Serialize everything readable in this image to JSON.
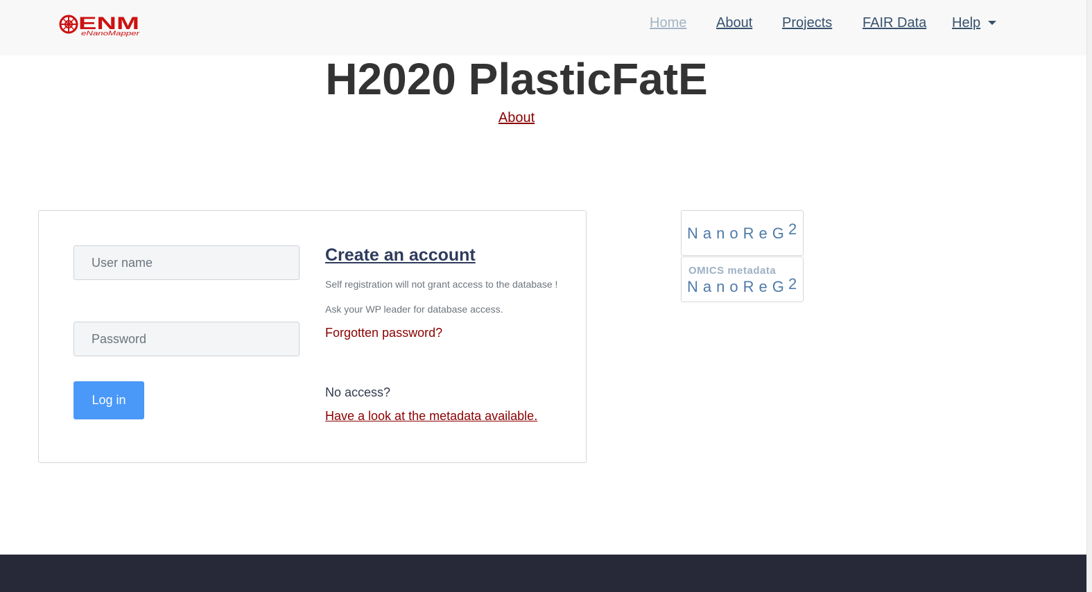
{
  "nav": {
    "logo_text": "ENM",
    "logo_subtext": "eNanoMapper",
    "items": [
      {
        "label": "Home",
        "active": true
      },
      {
        "label": "About"
      },
      {
        "label": "Projects"
      },
      {
        "label": "FAIR Data"
      },
      {
        "label": "Help"
      }
    ]
  },
  "header": {
    "title": "H2020 PlasticFatE",
    "about_link": "About"
  },
  "login": {
    "username_placeholder": "User name",
    "password_placeholder": "Password",
    "login_button": "Log in",
    "create_account": "Create an account",
    "self_registration_note": "Self registration will not grant access to the database ! Ask your WP leader for database access.",
    "forgot_password": "Forgotten password?",
    "no_access": "No access?",
    "metadata_link": "Have a look at the metadata available."
  },
  "badges": [
    {
      "word": "NanoReG",
      "sup": "2"
    },
    {
      "subtitle": "OMICS metadata",
      "word": "NanoReG",
      "sup": "2"
    }
  ],
  "colors": {
    "navbar_bg": "#f8f8f8",
    "nav_link": "#36516e",
    "nav_link_active": "#a3b4c6",
    "brand_red": "#cc1111",
    "link_dark_red": "#8b0000",
    "primary_button": "#4a98f7",
    "footer_bg": "#272838"
  }
}
